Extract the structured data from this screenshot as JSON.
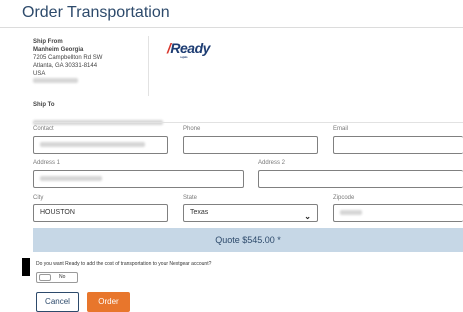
{
  "page": {
    "title": "Order Transportation"
  },
  "ship_from": {
    "label": "Ship From",
    "name": "Manheim Georgia",
    "street": "7205 Campbellton Rd SW",
    "city_line": "Atlanta, GA 30331-8144",
    "country": "USA"
  },
  "logo": {
    "text": "Ready",
    "subtext": "Logistics"
  },
  "ship_to": {
    "label": "Ship To"
  },
  "form": {
    "contact_label": "Contact",
    "phone_label": "Phone",
    "phone_value": "",
    "email_label": "Email",
    "address1_label": "Address 1",
    "address2_label": "Address 2",
    "address2_value": "",
    "city_label": "City",
    "city_value": "HOUSTON",
    "state_label": "State",
    "state_value": "Texas",
    "zipcode_label": "Zipcode"
  },
  "quote": {
    "text": "Quote $545.00 *"
  },
  "nextgear": {
    "question": "Do you want Ready to add the cost of transportation to your Nextgear account?",
    "toggle_label": "No"
  },
  "buttons": {
    "cancel": "Cancel",
    "order": "Order"
  },
  "colors": {
    "title": "#2d4a6b",
    "quote_bar": "#c6d7e6",
    "order_button": "#e8762c",
    "logo": "#1e3d73",
    "logo_accent": "#d9362b"
  }
}
